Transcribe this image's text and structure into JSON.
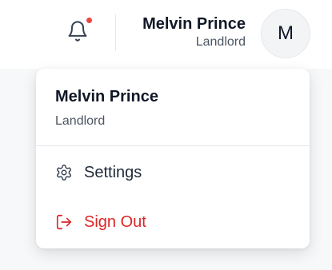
{
  "header": {
    "user": {
      "name": "Melvin Prince",
      "role": "Landlord",
      "initial": "M"
    },
    "notifications": {
      "icon": "bell-icon",
      "has_unread": true,
      "dot_color": "#ef4444"
    }
  },
  "dropdown": {
    "user": {
      "name": "Melvin Prince",
      "role": "Landlord"
    },
    "items": [
      {
        "label": "Settings",
        "icon": "gear-icon",
        "color": "#1f2937"
      },
      {
        "label": "Sign Out",
        "icon": "sign-out-icon",
        "color": "#dc2626"
      }
    ]
  }
}
